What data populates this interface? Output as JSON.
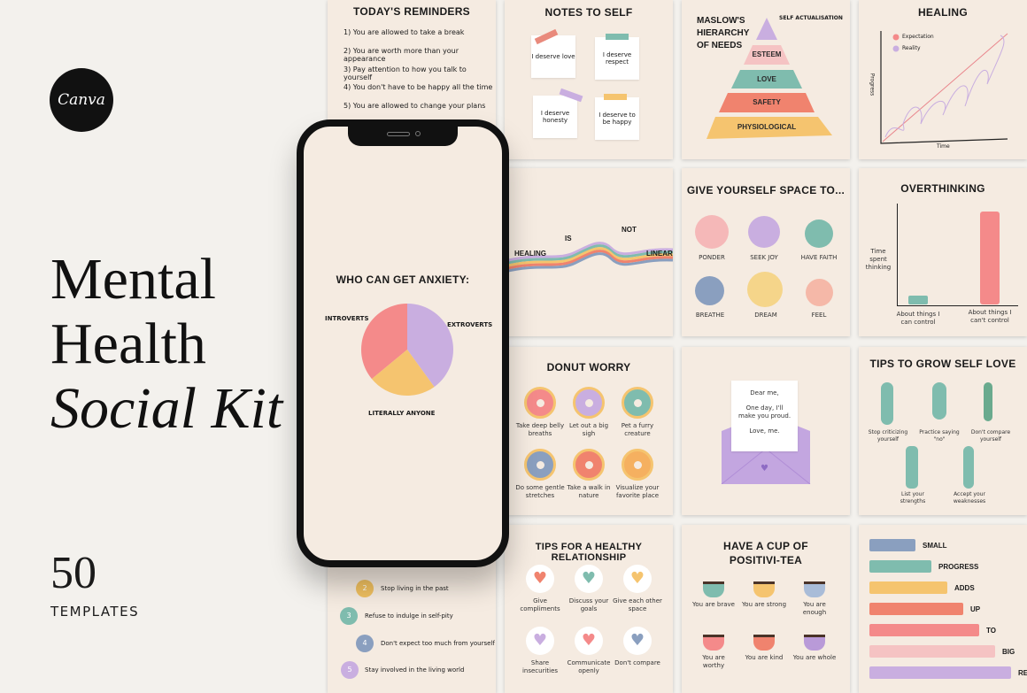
{
  "brand": {
    "logo": "Canva",
    "title_line1": "Mental",
    "title_line2": "Health",
    "title_line3": "Social Kit",
    "count": "50",
    "count_label": "TEMPLATES"
  },
  "reminders": {
    "title": "TODAY'S REMINDERS",
    "items": [
      "1) You are allowed to take a break",
      "2) You are worth more than your appearance",
      "3) Pay attention to how you talk to yourself",
      "4) You don't have to be happy all the time",
      "5) You are allowed to change your plans"
    ]
  },
  "notes": {
    "title": "NOTES TO SELF",
    "items": [
      "I deserve love",
      "I deserve respect",
      "I deserve honesty",
      "I deserve to be happy"
    ]
  },
  "maslow": {
    "title": "MASLOW'S HIERARCHY OF NEEDS",
    "levels": [
      "SELF ACTUALISATION",
      "ESTEEM",
      "LOVE",
      "SAFETY",
      "PHYSIOLOGICAL"
    ]
  },
  "healing": {
    "title": "HEALING",
    "legend": [
      "Expectation",
      "Reality"
    ],
    "ylabel": "Progress",
    "xlabel": "Time"
  },
  "linear": {
    "words": [
      "HEALING",
      "IS",
      "NOT",
      "LINEAR"
    ]
  },
  "space": {
    "title": "GIVE YOURSELF SPACE TO...",
    "items": [
      "PONDER",
      "SEEK JOY",
      "HAVE FAITH",
      "BREATHE",
      "DREAM",
      "FEEL"
    ]
  },
  "overthinking": {
    "title": "OVERTHINKING",
    "ylabel": "Time spent thinking",
    "bars": [
      {
        "label": "About things I can control",
        "value": 0.1,
        "color": "#7fbcae"
      },
      {
        "label": "About things I can't control",
        "value": 1.0,
        "color": "#f48a8a"
      }
    ]
  },
  "phone": {
    "title": "WHO CAN GET ANXIETY:",
    "slices": [
      {
        "label": "INTROVERTS",
        "value": 36,
        "color": "#f48a8a"
      },
      {
        "label": "EXTROVERTS",
        "value": 40,
        "color": "#c9aee0"
      },
      {
        "label": "LITERALLY ANYONE",
        "value": 24,
        "color": "#f5c46f"
      }
    ]
  },
  "donut": {
    "title": "DONUT WORRY",
    "items": [
      "Take deep belly breaths",
      "Let out a big sigh",
      "Pet a furry creature",
      "Do some gentle stretches",
      "Take a walk in nature",
      "Visualize your favorite place"
    ]
  },
  "letter": {
    "lines": [
      "Dear me,",
      "One day, I'll make you proud.",
      "Love, me."
    ]
  },
  "selflove": {
    "title": "TIPS TO GROW SELF LOVE",
    "items": [
      "Stop criticizing yourself",
      "Practice saying \"no\"",
      "Don't compare yourself",
      "List your strengths",
      "Accept your weaknesses"
    ]
  },
  "steps": {
    "items": [
      {
        "n": "2",
        "text": "Stop living in the past",
        "color": "#f0c060"
      },
      {
        "n": "3",
        "text": "Refuse to indulge in self-pity",
        "color": "#7fbcae"
      },
      {
        "n": "4",
        "text": "Don't expect too much from yourself",
        "color": "#8a9fbf"
      },
      {
        "n": "5",
        "text": "Stay involved in the living world",
        "color": "#c9aee0"
      }
    ]
  },
  "relationship": {
    "title": "TIPS FOR A HEALTHY RELATIONSHIP",
    "items": [
      "Give compliments",
      "Discuss your goals",
      "Give each other space",
      "Share insecurities",
      "Communicate openly",
      "Don't compare"
    ]
  },
  "tea": {
    "title": "HAVE A CUP OF POSITIVI-TEA",
    "items": [
      "You are brave",
      "You are strong",
      "You are enough",
      "You are worthy",
      "You are kind",
      "You are whole"
    ]
  },
  "progress": {
    "items": [
      {
        "label": "SMALL",
        "value": 1,
        "color": "#8a9fbf"
      },
      {
        "label": "PROGRESS",
        "value": 2,
        "color": "#7fbcae"
      },
      {
        "label": "ADDS",
        "value": 3,
        "color": "#f5c46f"
      },
      {
        "label": "UP",
        "value": 4,
        "color": "#f0836e"
      },
      {
        "label": "TO",
        "value": 5,
        "color": "#f48a8a"
      },
      {
        "label": "BIG",
        "value": 6,
        "color": "#f5c3c3"
      },
      {
        "label": "RESULTS",
        "value": 7,
        "color": "#c9aee0"
      }
    ]
  }
}
